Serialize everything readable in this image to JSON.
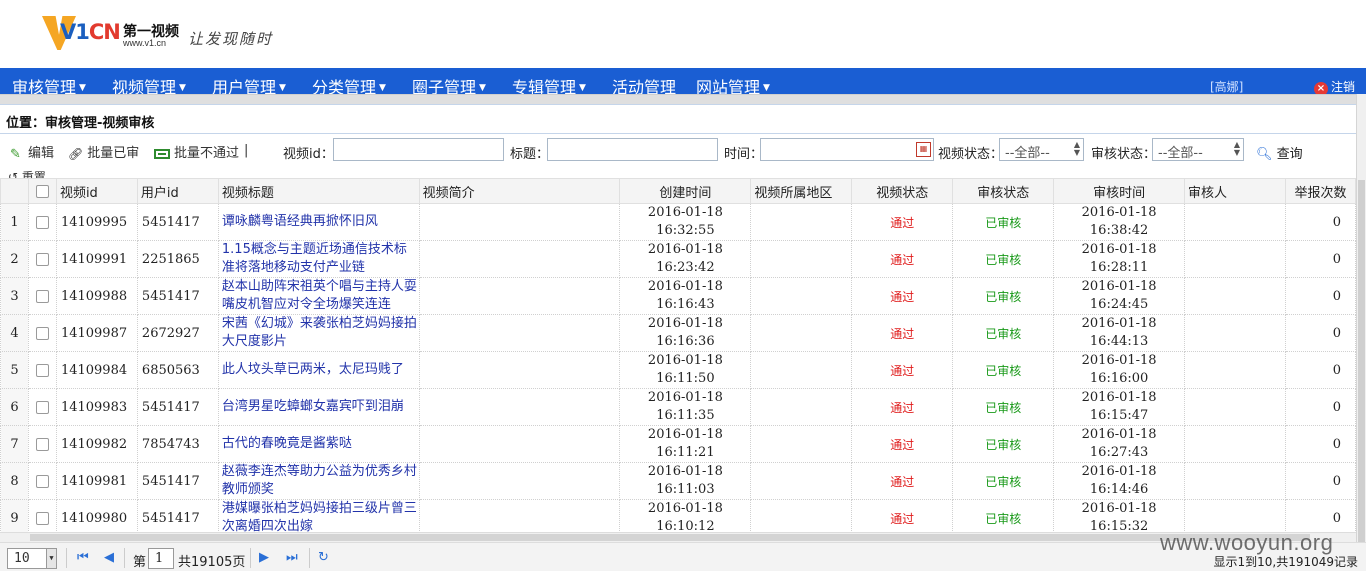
{
  "header": {
    "logo_text_v1": "V1",
    "logo_text_cn": "CN",
    "brand_name": "第一视频",
    "brand_url": "www.v1.cn",
    "slogan": "让发现随时"
  },
  "nav": {
    "items": [
      {
        "label": "审核管理",
        "has_caret": true
      },
      {
        "label": "视频管理",
        "has_caret": true
      },
      {
        "label": "用户管理",
        "has_caret": true
      },
      {
        "label": "分类管理",
        "has_caret": true
      },
      {
        "label": "圈子管理",
        "has_caret": true
      },
      {
        "label": "专辑管理",
        "has_caret": true
      },
      {
        "label": "活动管理",
        "has_caret": false
      },
      {
        "label": "网站管理",
        "has_caret": true
      }
    ],
    "caret": "▼",
    "user": "[高娜]",
    "logout": "注销"
  },
  "location": "位置：审核管理-视频审核",
  "toolbar": {
    "edit": "编辑",
    "batch_approve": "批量已审",
    "batch_reject": "批量不通过",
    "separator": "|",
    "video_id_label": "视频id：",
    "title_label": "标题：",
    "time_label": "时间：",
    "video_status_label": "视频状态：",
    "video_status_value": "--全部--",
    "review_status_label": "审核状态：",
    "review_status_value": "--全部--",
    "search": "查询",
    "reset": "重置"
  },
  "table": {
    "columns": [
      "视频id",
      "用户id",
      "视频标题",
      "视频简介",
      "创建时间",
      "视频所属地区",
      "视频状态",
      "审核状态",
      "审核时间",
      "审核人",
      "举报次数"
    ],
    "rows": [
      {
        "n": "1",
        "vid": "14109995",
        "uid": "5451417",
        "title": "谭咏麟粤语经典再掀怀旧风",
        "desc": "",
        "created_date": "2016-01-18",
        "created_time": "16:32:55",
        "region": "",
        "vstatus": "通过",
        "rstatus": "已审核",
        "rdate": "2016-01-18",
        "rtime": "16:38:42",
        "reviewer": "",
        "reports": "0"
      },
      {
        "n": "2",
        "vid": "14109991",
        "uid": "2251865",
        "title": "1.15概念与主题近场通信技术标准将落地移动支付产业链",
        "desc": "",
        "created_date": "2016-01-18",
        "created_time": "16:23:42",
        "region": "",
        "vstatus": "通过",
        "rstatus": "已审核",
        "rdate": "2016-01-18",
        "rtime": "16:28:11",
        "reviewer": "",
        "reports": "0"
      },
      {
        "n": "3",
        "vid": "14109988",
        "uid": "5451417",
        "title": "赵本山助阵宋祖英个唱与主持人耍嘴皮机智应对令全场爆笑连连",
        "desc": "",
        "created_date": "2016-01-18",
        "created_time": "16:16:43",
        "region": "",
        "vstatus": "通过",
        "rstatus": "已审核",
        "rdate": "2016-01-18",
        "rtime": "16:24:45",
        "reviewer": "",
        "reports": "0"
      },
      {
        "n": "4",
        "vid": "14109987",
        "uid": "2672927",
        "title": "宋茜《幻城》来袭张柏芝妈妈接拍大尺度影片",
        "desc": "",
        "created_date": "2016-01-18",
        "created_time": "16:16:36",
        "region": "",
        "vstatus": "通过",
        "rstatus": "已审核",
        "rdate": "2016-01-18",
        "rtime": "16:44:13",
        "reviewer": "",
        "reports": "0"
      },
      {
        "n": "5",
        "vid": "14109984",
        "uid": "6850563",
        "title": "此人坟头草已两米，太尼玛贱了",
        "desc": "",
        "created_date": "2016-01-18",
        "created_time": "16:11:50",
        "region": "",
        "vstatus": "通过",
        "rstatus": "已审核",
        "rdate": "2016-01-18",
        "rtime": "16:16:00",
        "reviewer": "",
        "reports": "0"
      },
      {
        "n": "6",
        "vid": "14109983",
        "uid": "5451417",
        "title": "台湾男星吃蟑螂女嘉宾吓到泪崩",
        "desc": "",
        "created_date": "2016-01-18",
        "created_time": "16:11:35",
        "region": "",
        "vstatus": "通过",
        "rstatus": "已审核",
        "rdate": "2016-01-18",
        "rtime": "16:15:47",
        "reviewer": "",
        "reports": "0"
      },
      {
        "n": "7",
        "vid": "14109982",
        "uid": "7854743",
        "title": "古代的春晚竟是酱紫哒",
        "desc": "",
        "created_date": "2016-01-18",
        "created_time": "16:11:21",
        "region": "",
        "vstatus": "通过",
        "rstatus": "已审核",
        "rdate": "2016-01-18",
        "rtime": "16:27:43",
        "reviewer": "",
        "reports": "0"
      },
      {
        "n": "8",
        "vid": "14109981",
        "uid": "5451417",
        "title": "赵薇李连杰等助力公益为优秀乡村教师颁奖",
        "desc": "",
        "created_date": "2016-01-18",
        "created_time": "16:11:03",
        "region": "",
        "vstatus": "通过",
        "rstatus": "已审核",
        "rdate": "2016-01-18",
        "rtime": "16:14:46",
        "reviewer": "",
        "reports": "0"
      },
      {
        "n": "9",
        "vid": "14109980",
        "uid": "5451417",
        "title": "港媒曝张柏芝妈妈接拍三级片曾三次离婚四次出嫁",
        "desc": "",
        "created_date": "2016-01-18",
        "created_time": "16:10:12",
        "region": "",
        "vstatus": "通过",
        "rstatus": "已审核",
        "rdate": "2016-01-18",
        "rtime": "16:15:32",
        "reviewer": "",
        "reports": "0"
      }
    ]
  },
  "pager": {
    "page_size": "10",
    "page_label": "第",
    "current_page": "1",
    "total_pages": "共19105页",
    "info": "显示1到10,共191049记录"
  },
  "watermark": "www.wooyun.org",
  "colors": {
    "nav_bg": "#1a5ed3",
    "link": "#2233aa",
    "status_pass": "#e01c1c",
    "status_reviewed": "#1a9a1a"
  }
}
